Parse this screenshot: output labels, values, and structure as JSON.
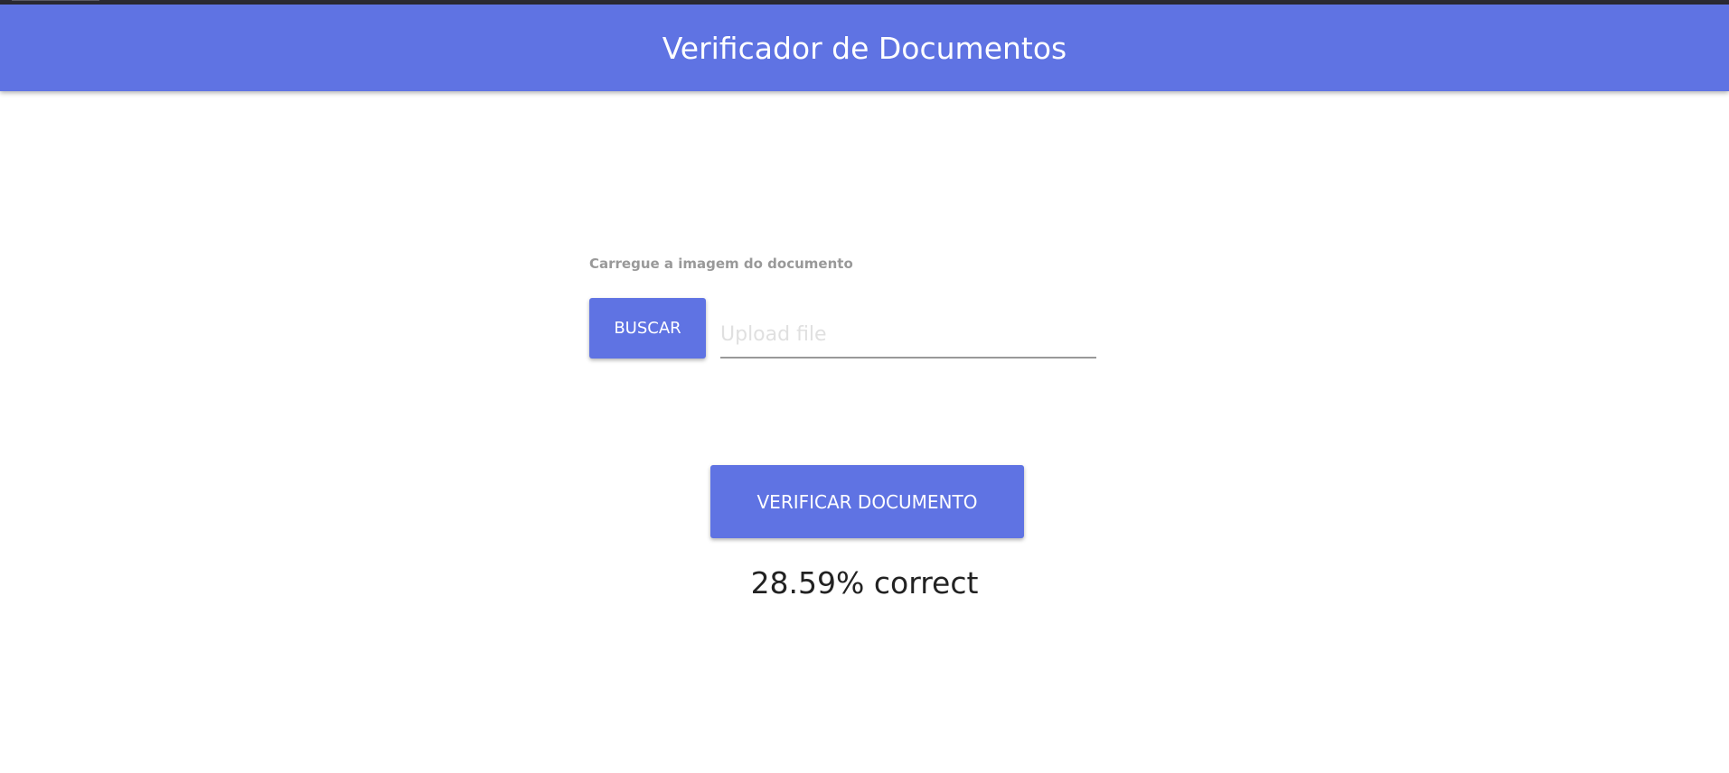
{
  "header": {
    "title": "Verificador de Documentos"
  },
  "form": {
    "label": "Carregue a imagem do documento",
    "browse_label": "BUSCAR",
    "upload_placeholder": "Upload file",
    "upload_value": ""
  },
  "verify_label": "VERIFICAR DOCUMENTO",
  "result_text": "28.59% correct",
  "colors": {
    "accent": "#5f73e3"
  }
}
